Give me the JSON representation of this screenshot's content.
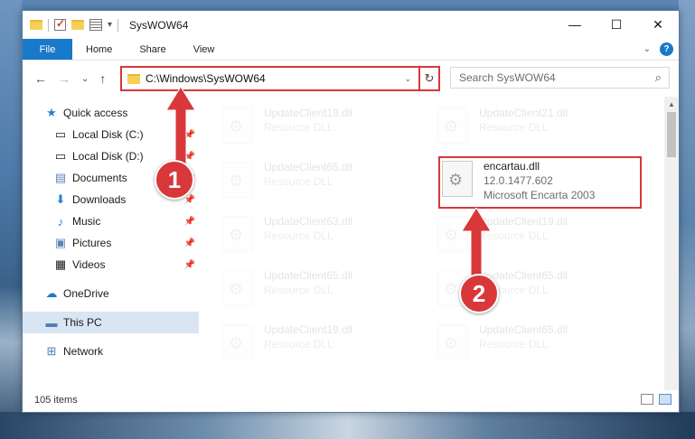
{
  "window": {
    "title": "SysWOW64",
    "minimize": "—",
    "maximize": "☐",
    "close": "✕"
  },
  "ribbon": {
    "tabs": [
      "File",
      "Home",
      "Share",
      "View"
    ],
    "help": "?"
  },
  "nav": {
    "back": "←",
    "forward": "→",
    "recent": "⌄",
    "up": "↑",
    "address": "C:\\Windows\\SysWOW64",
    "refresh": "↻",
    "search_placeholder": "Search SysWOW64"
  },
  "sidebar": {
    "items": [
      {
        "label": "Quick access",
        "icon": "star-icon",
        "pinned": false
      },
      {
        "label": "Local Disk (C:)",
        "icon": "drive-icon",
        "pinned": true
      },
      {
        "label": "Local Disk (D:)",
        "icon": "drive-icon",
        "pinned": true
      },
      {
        "label": "Documents",
        "icon": "documents-icon",
        "pinned": true
      },
      {
        "label": "Downloads",
        "icon": "download-icon",
        "pinned": true
      },
      {
        "label": "Music",
        "icon": "music-icon",
        "pinned": true
      },
      {
        "label": "Pictures",
        "icon": "pictures-icon",
        "pinned": true
      },
      {
        "label": "Videos",
        "icon": "videos-icon",
        "pinned": true
      },
      {
        "label": "OneDrive",
        "icon": "cloud-icon",
        "pinned": false
      },
      {
        "label": "This PC",
        "icon": "computer-icon",
        "pinned": false
      },
      {
        "label": "Network",
        "icon": "network-icon",
        "pinned": false
      }
    ]
  },
  "files": [
    {
      "name": "UpdateClient19.dll",
      "line1": "Resource DLL",
      "line2": ""
    },
    {
      "name": "UpdateClient21.dll",
      "line1": "Resource DLL",
      "line2": ""
    },
    {
      "name": "UpdateClient65.dll",
      "line1": "Resource DLL",
      "line2": ""
    },
    {
      "name": "encartau.dll",
      "line1": "12.0.1477.602",
      "line2": "Microsoft Encarta 2003"
    },
    {
      "name": "UpdateClient63.dll",
      "line1": "Resource DLL",
      "line2": ""
    },
    {
      "name": "UpdateClient19.dll",
      "line1": "Resource DLL",
      "line2": ""
    },
    {
      "name": "UpdateClient65.dll",
      "line1": "Resource DLL",
      "line2": ""
    },
    {
      "name": "UpdateClient65.dll",
      "line1": "Resource DLL",
      "line2": ""
    },
    {
      "name": "UpdateClient19.dll",
      "line1": "Resource DLL",
      "line2": ""
    },
    {
      "name": "UpdateClient65.dll",
      "line1": "Resource DLL",
      "line2": ""
    }
  ],
  "status": {
    "item_count": "105 items"
  },
  "annotations": {
    "step1": "1",
    "step2": "2",
    "color": "#d8383a"
  }
}
